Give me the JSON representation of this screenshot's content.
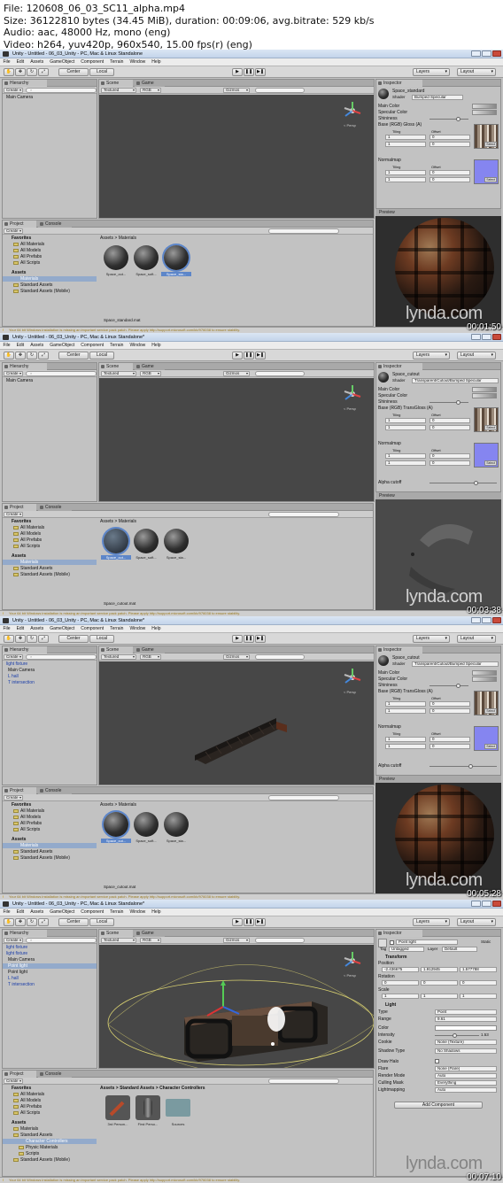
{
  "header": {
    "line1": "File: 120608_06_03_SC11_alpha.mp4",
    "line2": "Size: 36122810 bytes (34.45 MiB), duration: 00:09:06, avg.bitrate: 529 kb/s",
    "line3": "Audio: aac, 48000 Hz, mono (eng)",
    "line4": "Video: h264, yuv420p, 960x540, 15.00 fps(r) (eng)"
  },
  "menu": [
    "File",
    "Edit",
    "Assets",
    "GameObject",
    "Component",
    "Terrain",
    "Window",
    "Help"
  ],
  "toolbar": {
    "center": "Center",
    "local": "Local",
    "layers": "Layers",
    "layout": "Layout"
  },
  "labels": {
    "hierarchy": "Hierarchy",
    "create": "Create",
    "scene": "Scene",
    "game": "Game",
    "textured": "Textured",
    "rgb": "RGB",
    "gizmos": "Gizmos",
    "project": "Project",
    "console": "Console",
    "inspector": "Inspector",
    "preview": "Preview",
    "persp": "< Persp",
    "favorites": "Favorites",
    "all_materials": "All Materials",
    "all_models": "All Models",
    "all_prefabs": "All Prefabs",
    "all_scripts": "All Scripts",
    "assets": "Assets",
    "materials": "Materials",
    "standard_assets": "Standard Assets",
    "standard_assets_mobile": "Standard Assets (Mobile)",
    "main_camera": "Main Camera",
    "watermark": "lynda.com",
    "status": "Your 64 bit Windows installation is missing an important service pack patch. Please apply http://support.microsoft.com/kb/976038 to ensure stability.",
    "shader": "Shader",
    "main_color": "Main Color",
    "specular_color": "Specular Color",
    "shininess": "Shininess",
    "base_gloss": "Base (RGB) Gloss (A)",
    "base_transgloss": "Base (RGB) TransGloss (A)",
    "tiling": "Tiling",
    "offset": "Offset",
    "normalmap": "Normalmap",
    "alpha_cutoff": "Alpha cutoff",
    "select": "Select"
  },
  "frames": [
    {
      "title": "Unity - Untitled - 06_03_Unity - PC, Mac & Linux Standalone",
      "timestamp": "00:01:50",
      "material": "Space_standard",
      "shader": "Bumped Specular",
      "breadcrumb": "Assets > Materials",
      "thumbs": [
        "Space_out...",
        "Space_soft...",
        "Space_sta..."
      ],
      "selected_file": "Space_standard.mat"
    },
    {
      "title": "Unity - Untitled - 06_03_Unity - PC, Mac & Linux Standalone*",
      "timestamp": "00:03:38",
      "material": "Space_cutout",
      "shader": "Transparent/Cutout/Bumped Specular",
      "breadcrumb": "Assets > Materials",
      "thumbs": [
        "Space_out...",
        "Space_soft...",
        "Space_sta..."
      ],
      "selected_file": "Space_cutout.mat"
    },
    {
      "title": "Unity - Untitled - 06_03_Unity - PC, Mac & Linux Standalone*",
      "timestamp": "00:05:28",
      "material": "Space_cutout",
      "shader": "Transparent/Cutout/Bumped Specular",
      "breadcrumb": "Assets > Materials",
      "thumbs": [
        "Space_cut...",
        "Space_soft...",
        "Space_sta..."
      ],
      "selected_file": "Space_cutout.mat",
      "hierarchy": [
        "light fixture",
        "Main Camera",
        "L hall",
        "T intersection"
      ]
    },
    {
      "title": "Unity - Untitled - 06_03_Unity - PC, Mac & Linux Standalone*",
      "timestamp": "00:07:10",
      "breadcrumb": "Assets > Standard Assets > Character Controllers",
      "thumbs": [
        "3rd Person...",
        "First Perso...",
        "Sources"
      ],
      "hierarchy": [
        "light fixture",
        "light fixture",
        "Main Camera",
        "Point light",
        "Point light",
        "L hall",
        "T intersection"
      ],
      "project_tree": [
        "Materials",
        "Standard Assets",
        "Character Controllers",
        "Physic Materials",
        "Scripts"
      ],
      "inspector": {
        "name": "Point light",
        "tag_label": "Tag",
        "tag": "Untagged",
        "layer_label": "Layer",
        "layer": "Default",
        "static": "Static",
        "transform": "Transform",
        "position": "Position",
        "pos_x": "-2.436675",
        "pos_y": "1.912945",
        "pos_z": "1.577788",
        "rotation": "Rotation",
        "rot": "0",
        "scale": "Scale",
        "scl": "1",
        "light": "Light",
        "type_label": "Type",
        "type": "Point",
        "range_label": "Range",
        "range": "9.61",
        "color_label": "Color",
        "intensity_label": "Intensity",
        "intensity": "1.53",
        "cookie_label": "Cookie",
        "cookie": "None (Texture)",
        "shadow_label": "Shadow Type",
        "shadow": "No Shadows",
        "draw_halo": "Draw Halo",
        "flare_label": "Flare",
        "flare": "None (Flare)",
        "render_mode_label": "Render Mode",
        "render_mode": "Auto",
        "culling_label": "Culling Mask",
        "culling": "Everything",
        "lightmapping_label": "Lightmapping",
        "lightmapping": "Auto",
        "add_component": "Add Component"
      }
    }
  ]
}
